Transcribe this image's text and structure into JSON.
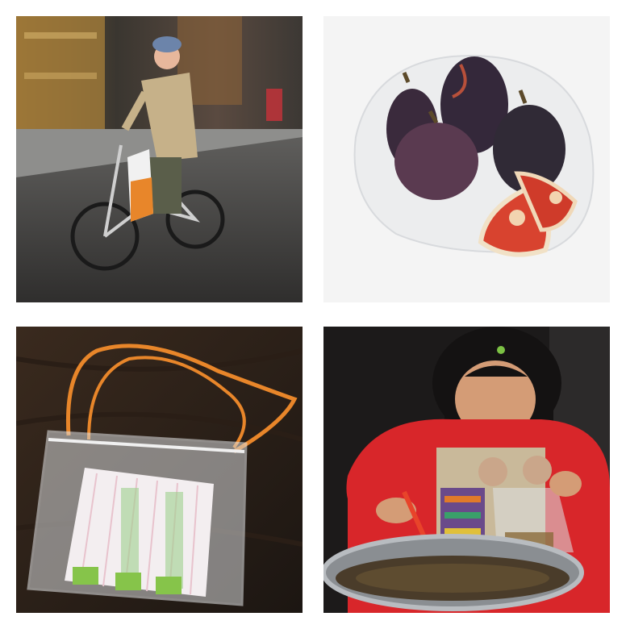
{
  "grid": {
    "tiles": [
      {
        "subject": "person-riding-bicycle-with-shopping-bag",
        "selected": false
      },
      {
        "subject": "figs-in-plastic-bag",
        "selected": false
      },
      {
        "subject": "clear-plastic-pouch-with-orange-cord",
        "selected": false
      },
      {
        "subject": "girl-in-red-shirt-bagging-food",
        "selected": false
      }
    ]
  },
  "colors": {
    "background": "#ffffff",
    "bag_orange": "#e8862a",
    "shirt_red": "#d8262a",
    "fig_purple": "#3f2a3e",
    "fig_flesh": "#d8432f"
  }
}
